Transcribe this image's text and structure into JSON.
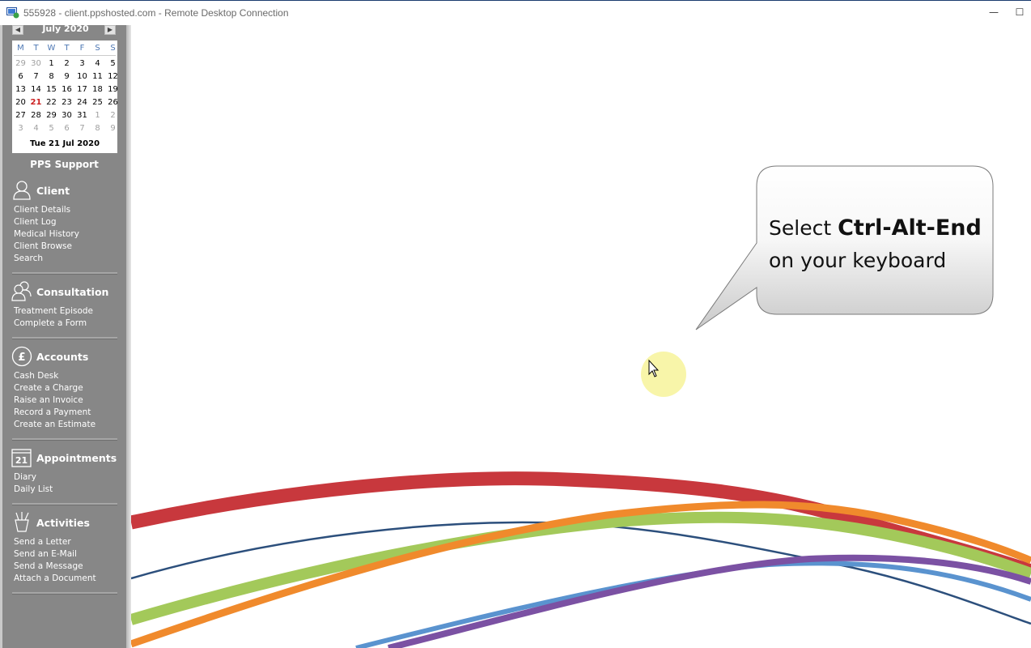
{
  "window": {
    "title": "555928 - client.ppshosted.com - Remote Desktop Connection",
    "minimize_symbol": "—",
    "maximize_symbol": "☐"
  },
  "calendar": {
    "month_label": "July 2020",
    "weekdays": [
      "M",
      "T",
      "W",
      "T",
      "F",
      "S",
      "S"
    ],
    "weeks": [
      [
        "29",
        "30",
        "1",
        "2",
        "3",
        "4",
        "5"
      ],
      [
        "6",
        "7",
        "8",
        "9",
        "10",
        "11",
        "12"
      ],
      [
        "13",
        "14",
        "15",
        "16",
        "17",
        "18",
        "19"
      ],
      [
        "20",
        "21",
        "22",
        "23",
        "24",
        "25",
        "26"
      ],
      [
        "27",
        "28",
        "29",
        "30",
        "31",
        "1",
        "2"
      ],
      [
        "3",
        "4",
        "5",
        "6",
        "7",
        "8",
        "9"
      ]
    ],
    "today_label": "Tue 21 Jul 2020"
  },
  "sidebar": {
    "title": "PPS Support",
    "sections": [
      {
        "title": "Client",
        "icon": "person-icon",
        "items": [
          "Client Details",
          "Client Log",
          "Medical History",
          "Client Browse",
          "Search"
        ]
      },
      {
        "title": "Consultation",
        "icon": "people-icon",
        "items": [
          "Treatment Episode",
          "Complete a Form"
        ]
      },
      {
        "title": "Accounts",
        "icon": "pound-icon",
        "items": [
          "Cash Desk",
          "Create a Charge",
          "Raise an Invoice",
          "Record a Payment",
          "Create an Estimate"
        ]
      },
      {
        "title": "Appointments",
        "icon": "calendar-icon",
        "items": [
          "Diary",
          "Daily List"
        ]
      },
      {
        "title": "Activities",
        "icon": "pen-cup-icon",
        "items": [
          "Send a Letter",
          "Send an E-Mail",
          "Send a Message",
          "Attach a Document"
        ]
      }
    ],
    "calendar_icon_number": "21",
    "pound_symbol": "£"
  },
  "callout": {
    "line1_prefix": "Select ",
    "line1_keys": "Ctrl-Alt-End",
    "line2": "on your keyboard"
  },
  "colors": {
    "sidebar_bg": "#878787",
    "wave_red": "#c8383d",
    "wave_orange": "#f08a2c",
    "wave_green": "#a3c95a",
    "wave_navy": "#2c4f7c",
    "wave_blue": "#5a93cf",
    "wave_purple": "#7b51a3",
    "cursor_highlight": "#f7f39a"
  }
}
